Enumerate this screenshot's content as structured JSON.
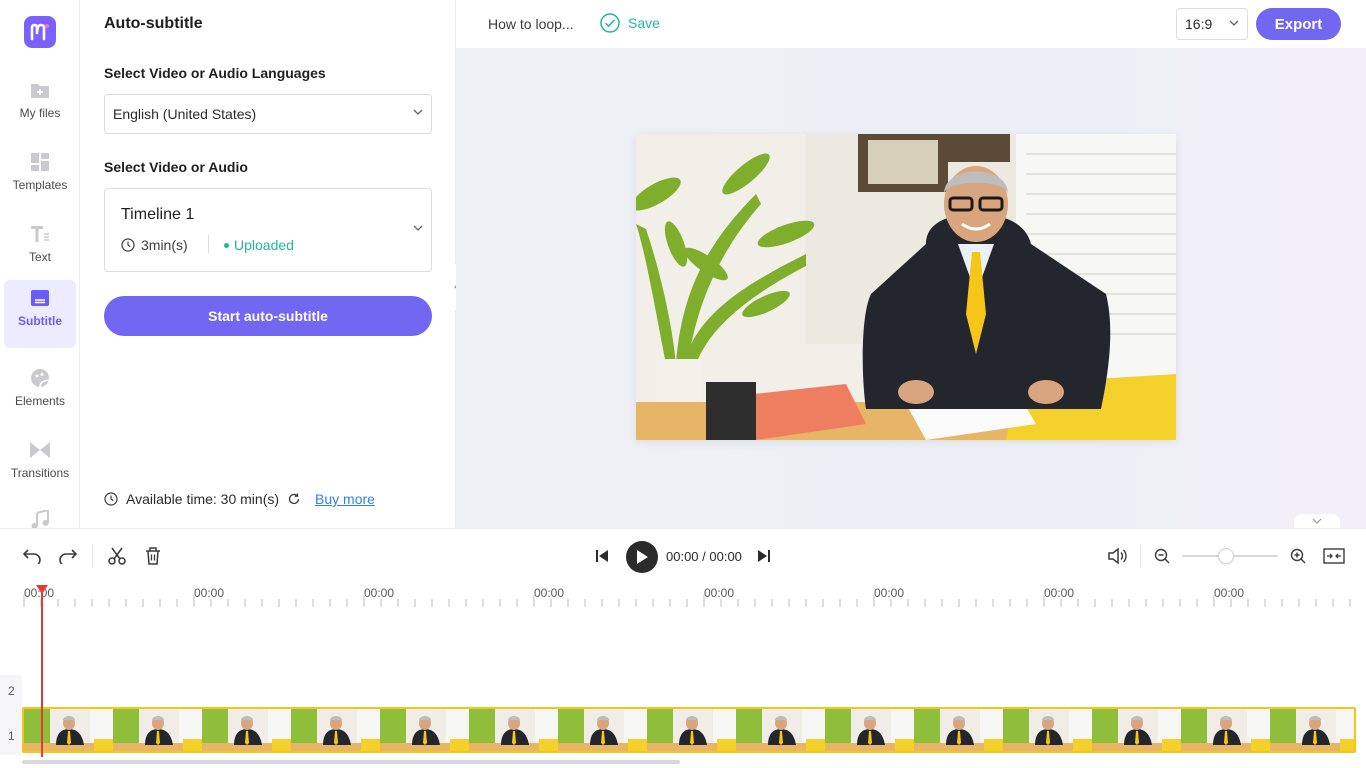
{
  "rail": {
    "items": [
      {
        "label": "My files",
        "icon": "folder-plus-icon"
      },
      {
        "label": "Templates",
        "icon": "templates-icon"
      },
      {
        "label": "Text",
        "icon": "text-icon"
      },
      {
        "label": "Subtitle",
        "icon": "subtitle-icon",
        "active": true
      },
      {
        "label": "Elements",
        "icon": "elements-icon"
      },
      {
        "label": "Transitions",
        "icon": "transitions-icon"
      },
      {
        "label": "",
        "icon": "music-icon"
      }
    ]
  },
  "panel": {
    "title": "Auto-subtitle",
    "language_label": "Select Video or Audio Languages",
    "language_value": "English (United States)",
    "source_label": "Select Video or Audio",
    "timeline_name": "Timeline 1",
    "timeline_duration": "3min(s)",
    "timeline_status": "Uploaded",
    "start_button": "Start auto-subtitle",
    "available_time": "Available time: 30 min(s)",
    "buy_more": "Buy more"
  },
  "topbar": {
    "project_name": "How to loop...",
    "save_label": "Save",
    "ratio": "16:9",
    "export_label": "Export"
  },
  "timeline": {
    "time_display": "00:00 / 00:00",
    "ruler_labels": [
      "00:00",
      "00:00",
      "00:00",
      "00:00",
      "00:00",
      "00:00",
      "00:00",
      "00:00"
    ],
    "track_numbers": [
      "2",
      "1"
    ]
  },
  "colors": {
    "accent": "#7267f0",
    "success": "#1fb89a",
    "link": "#2d7ff9",
    "playhead": "#e53935",
    "clip_border": "#f5c518"
  }
}
